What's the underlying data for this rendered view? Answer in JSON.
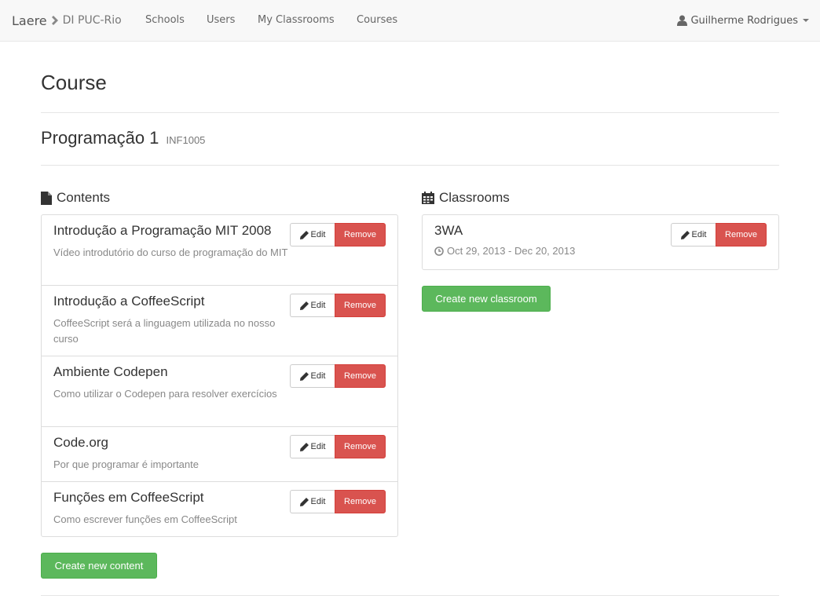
{
  "navbar": {
    "brand": "Laere",
    "context": "DI PUC-Rio",
    "links": [
      "Schools",
      "Users",
      "My Classrooms",
      "Courses"
    ],
    "user": "Guilherme Rodrigues"
  },
  "page": {
    "title": "Course",
    "course_name": "Programação 1",
    "course_code": "INF1005"
  },
  "contents": {
    "title": "Contents",
    "items": [
      {
        "title": "Introdução a Programação MIT 2008",
        "description": "Vídeo introdutório do curso de programação do MIT"
      },
      {
        "title": "Introdução a CoffeeScript",
        "description": "CoffeeScript será a linguagem utilizada no nosso curso"
      },
      {
        "title": "Ambiente Codepen",
        "description": "Como utilizar o Codepen para resolver exercícios"
      },
      {
        "title": "Code.org",
        "description": "Por que programar é importante"
      },
      {
        "title": "Funções em CoffeeScript",
        "description": "Como escrever funções em CoffeeScript"
      }
    ],
    "create_label": "Create new content"
  },
  "classrooms": {
    "title": "Classrooms",
    "items": [
      {
        "name": "3WA",
        "dates": "Oct 29, 2013 - Dec 20, 2013"
      }
    ],
    "create_label": "Create new classroom"
  },
  "actions": {
    "edit": "Edit",
    "remove": "Remove"
  },
  "colors": {
    "success": "#5cb85c",
    "danger": "#d9534f"
  }
}
